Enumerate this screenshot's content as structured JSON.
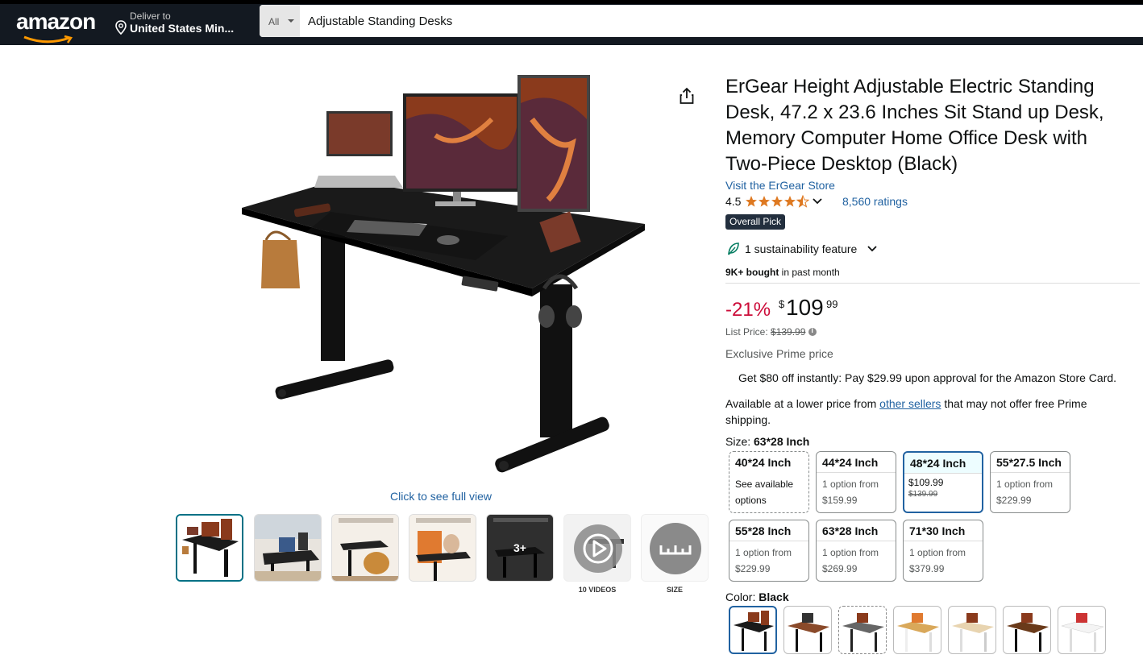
{
  "header": {
    "logo": "amazon",
    "deliver_small": "Deliver to",
    "deliver_big": "United States Min...",
    "search_category": "All",
    "search_value": "Adjustable Standing Desks"
  },
  "gallery": {
    "full_view": "Click to see full view",
    "overlay_count": "3+",
    "videos_label": "10 VIDEOS",
    "size_label": "SIZE"
  },
  "product": {
    "title": "ErGear Height Adjustable Electric Standing Desk, 47.2 x 23.6 Inches Sit Stand up Desk, Memory Computer Home Office Desk with Two-Piece Desktop (Black)",
    "store_link": "Visit the ErGear Store",
    "rating": "4.5",
    "ratings_count": "8,560 ratings",
    "badge": "Overall Pick",
    "sustainability": "1 sustainability feature",
    "bought_bold": "9K+ bought",
    "bought_rest": "in past month",
    "discount": "-21%",
    "price_symbol": "$",
    "price_whole": "109",
    "price_fraction": "99",
    "list_price_label": "List Price:",
    "list_price": "$139.99",
    "exclusive": "Exclusive Prime price",
    "offer": "Get $80 off instantly: Pay $29.99 upon approval for the Amazon Store Card.",
    "lower_prefix": "Available at a lower price from",
    "lower_link": "other sellers",
    "lower_suffix": "that may not offer free Prime shipping."
  },
  "size": {
    "label": "Size:",
    "selected": "63*28 Inch",
    "options": [
      {
        "name": "40*24 Inch",
        "sub1": "See available",
        "sub2": "options"
      },
      {
        "name": "44*24 Inch",
        "sub1": "1 option from",
        "sub2": "$159.99"
      },
      {
        "name": "48*24 Inch",
        "price": "$109.99",
        "strike": "$139.99"
      },
      {
        "name": "55*27.5 Inch",
        "sub1": "1 option from",
        "sub2": "$229.99"
      },
      {
        "name": "55*28 Inch",
        "sub1": "1 option from",
        "sub2": "$229.99"
      },
      {
        "name": "63*28 Inch",
        "sub1": "1 option from",
        "sub2": "$269.99"
      },
      {
        "name": "71*30 Inch",
        "sub1": "1 option from",
        "sub2": "$379.99"
      }
    ]
  },
  "color": {
    "label": "Color:",
    "selected": "Black"
  },
  "colors": {
    "accent_link": "#2162a1",
    "discount_red": "#cc0c39",
    "star_orange": "#de7921",
    "header_bg": "#131921"
  }
}
